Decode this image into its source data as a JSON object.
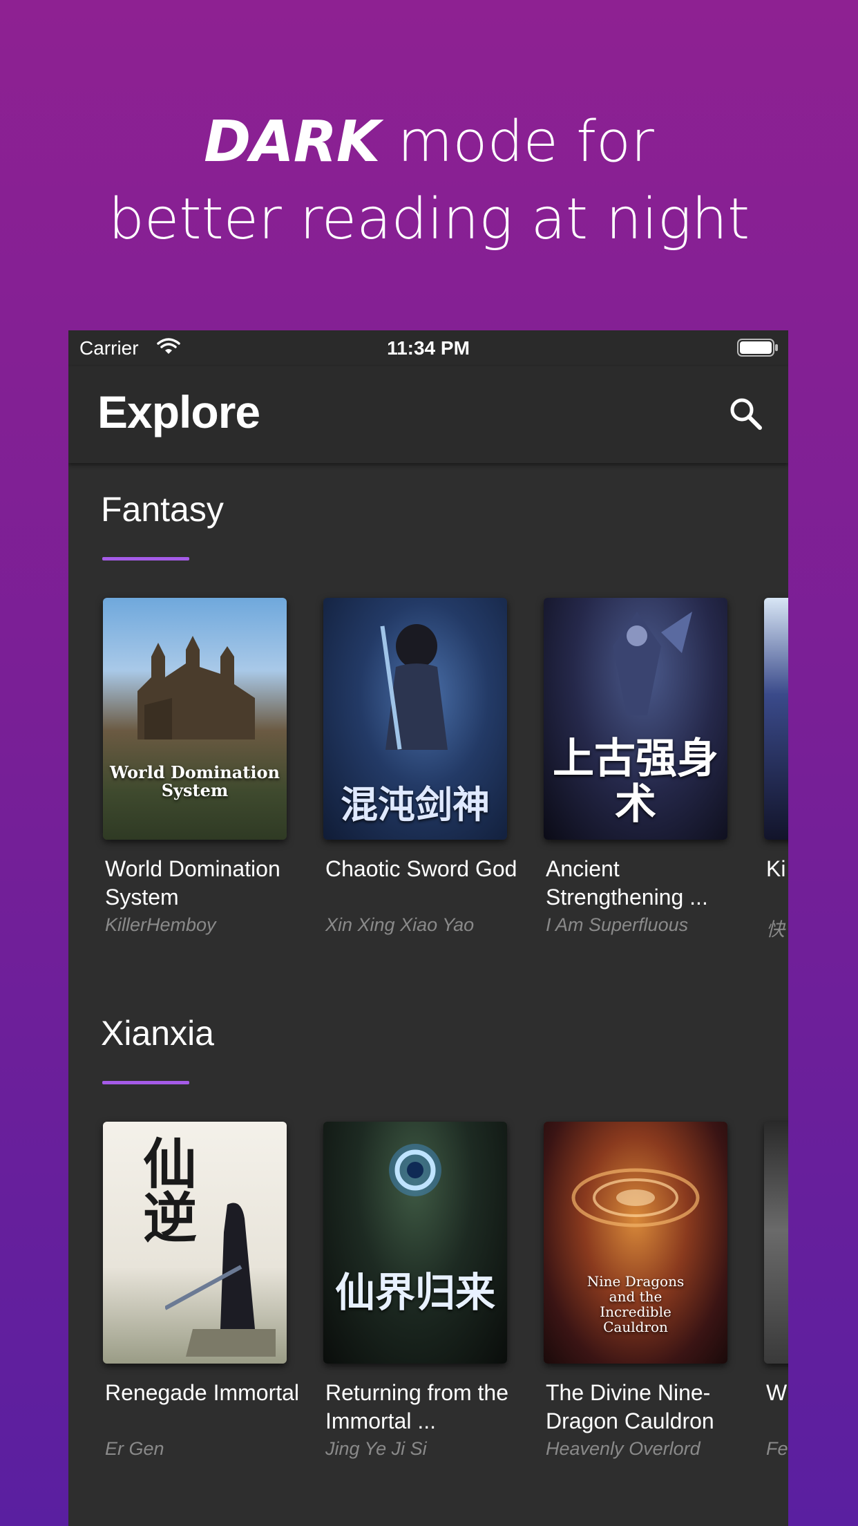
{
  "headline": {
    "strong": "DARK",
    "line1_rest": " mode for",
    "line2": "better reading at night"
  },
  "status_bar": {
    "carrier": "Carrier",
    "time": "11:34 PM"
  },
  "navbar": {
    "title": "Explore"
  },
  "accent_color": "#a55be8",
  "sections": [
    {
      "title": "Fantasy",
      "books": [
        {
          "title": "World Domination System",
          "author": "KillerHemboy",
          "cover_text": "World Domination System"
        },
        {
          "title": "Chaotic Sword God",
          "author": "Xin Xing Xiao Yao",
          "cover_text": "混沌剑神"
        },
        {
          "title": "Ancient Strengthening ...",
          "author": "I Am Superfluous",
          "cover_text": "上古强身术"
        },
        {
          "title": "Ki",
          "author": "快",
          "cover_text": ""
        }
      ]
    },
    {
      "title": "Xianxia",
      "books": [
        {
          "title": "Renegade Immortal",
          "author": "Er Gen",
          "cover_text": "仙逆"
        },
        {
          "title": "Returning from the Immortal ...",
          "author": "Jing Ye Ji Si",
          "cover_text": "仙界归来"
        },
        {
          "title": "The Divine Nine-Dragon Cauldron",
          "author": "Heavenly Overlord",
          "cover_text": "Nine Dragons and the Incredible Cauldron"
        },
        {
          "title": "W S",
          "author": "Fe",
          "cover_text": ""
        }
      ]
    }
  ]
}
